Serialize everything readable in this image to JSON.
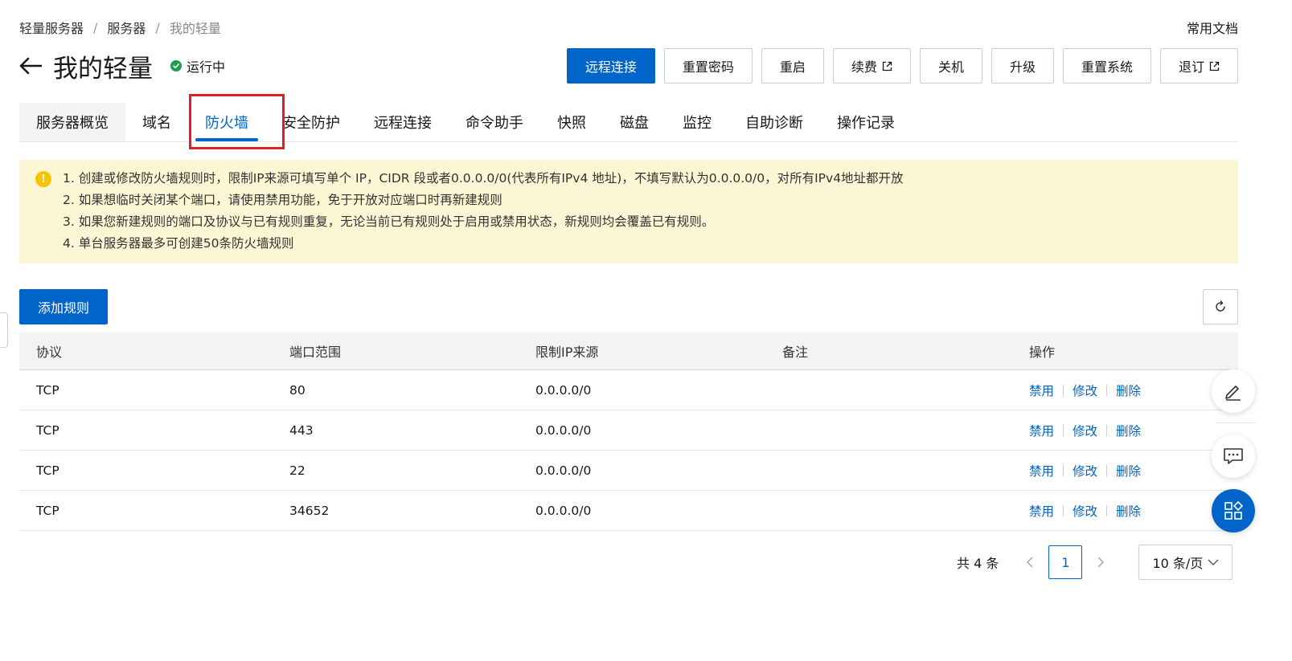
{
  "breadcrumb": {
    "items": [
      "轻量服务器",
      "服务器",
      "我的轻量"
    ],
    "separator": "/"
  },
  "header": {
    "doc_link": "常用文档",
    "title": "我的轻量",
    "status": "运行中",
    "status_color": "#1e9e4a"
  },
  "actions": [
    {
      "label": "远程连接",
      "primary": true
    },
    {
      "label": "重置密码"
    },
    {
      "label": "重启"
    },
    {
      "label": "续费",
      "external": true
    },
    {
      "label": "关机"
    },
    {
      "label": "升级"
    },
    {
      "label": "重置系统"
    },
    {
      "label": "退订",
      "external": true
    }
  ],
  "tabs": [
    "服务器概览",
    "域名",
    "防火墙",
    "安全防护",
    "远程连接",
    "命令助手",
    "快照",
    "磁盘",
    "监控",
    "自助诊断",
    "操作记录"
  ],
  "active_tab": "防火墙",
  "notice": {
    "icon": "warning-icon",
    "lines": [
      "1. 创建或修改防火墙规则时，限制IP来源可填写单个 IP，CIDR 段或者0.0.0.0/0(代表所有IPv4 地址)，不填写默认为0.0.0.0/0，对所有IPv4地址都开放",
      "2. 如果想临时关闭某个端口，请使用禁用功能，免于开放对应端口时再新建规则",
      "3. 如果您新建规则的端口及协议与已有规则重复，无论当前已有规则处于启用或禁用状态，新规则均会覆盖已有规则。",
      "4. 单台服务器最多可创建50条防火墙规则"
    ]
  },
  "toolbar": {
    "add_label": "添加规则"
  },
  "table": {
    "columns": [
      "协议",
      "端口范围",
      "限制IP来源",
      "备注",
      "操作"
    ],
    "rows": [
      {
        "protocol": "TCP",
        "port": "80",
        "source": "0.0.0.0/0",
        "note": ""
      },
      {
        "protocol": "TCP",
        "port": "443",
        "source": "0.0.0.0/0",
        "note": ""
      },
      {
        "protocol": "TCP",
        "port": "22",
        "source": "0.0.0.0/0",
        "note": ""
      },
      {
        "protocol": "TCP",
        "port": "34652",
        "source": "0.0.0.0/0",
        "note": ""
      }
    ],
    "ops": {
      "disable": "禁用",
      "edit": "修改",
      "delete": "删除"
    }
  },
  "pagination": {
    "total_label": "共 4 条",
    "current_page": "1",
    "page_size": "10 条/页"
  },
  "colors": {
    "accent": "#0064c8",
    "highlight_box": "#e02020",
    "notice_bg": "#fdf6d4"
  }
}
